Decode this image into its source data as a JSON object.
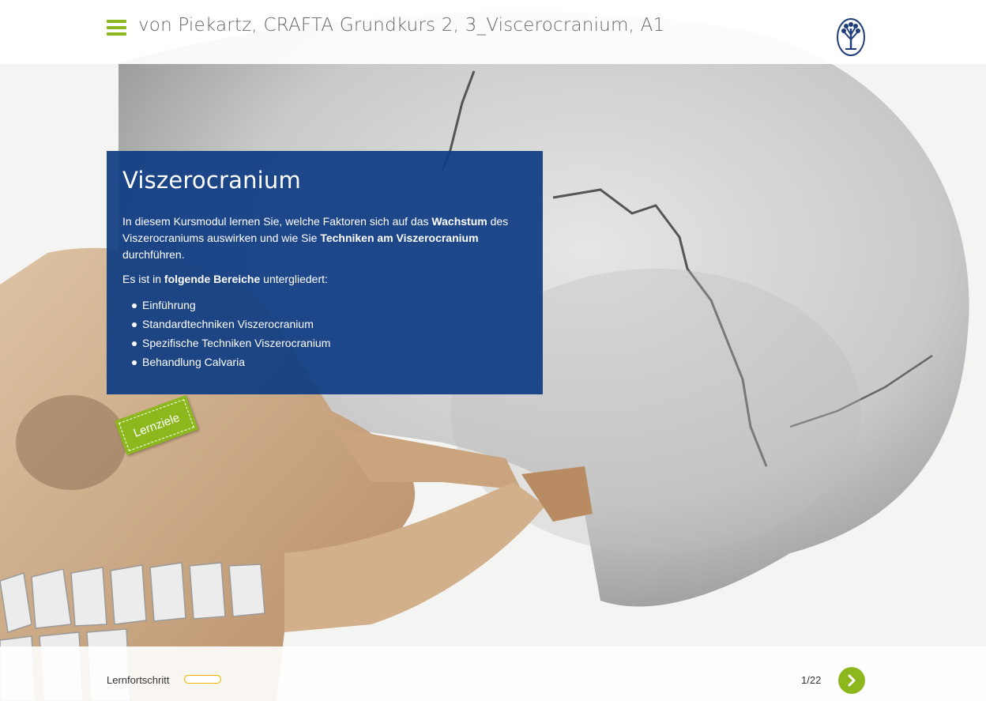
{
  "header": {
    "title": "von Piekartz, CRAFTA Grundkurs 2, 3_Viscerocranium, A1",
    "menu_icon": "hamburger-menu-icon",
    "logo_icon": "tree-logo-icon"
  },
  "card": {
    "heading": "Viszerocranium",
    "intro": {
      "t1": "In diesem Kursmodul lernen Sie, welche Faktoren sich auf das ",
      "b1": "Wachstum",
      "t2": " des Viszerocraniums auswirken und wie Sie ",
      "b2": "Techniken am Viszerocranium",
      "t3": " durchführen."
    },
    "areas": {
      "t1": "Es ist in ",
      "b1": "folgende Bereiche",
      "t2": " untergliedert:"
    },
    "items": [
      "Einführung",
      "Standardtechniken Viszerocranium",
      "Spezifische Techniken Viszerocranium",
      "Behandlung Calvaria"
    ]
  },
  "tag": {
    "label": "Lernziele"
  },
  "footer": {
    "progress_label": "Lernfortschritt",
    "progress_fraction": 0.0,
    "page": "1/22",
    "next_icon": "chevron-right-icon"
  },
  "colors": {
    "accent_green": "#8cb81e",
    "card_blue": "#0f3c82",
    "progress_yellow": "#f0b400"
  }
}
